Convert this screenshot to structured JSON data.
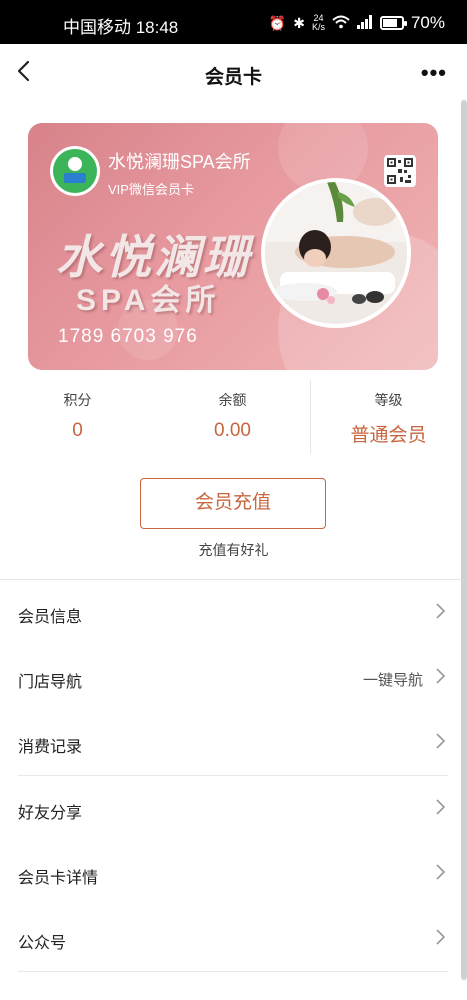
{
  "status_bar": {
    "carrier_time": "中国移动 18:48",
    "net_speed_top": "24",
    "net_speed_bottom": "K/s",
    "battery": "70%"
  },
  "navbar": {
    "title": "会员卡",
    "more": "•••"
  },
  "card": {
    "merchant_name": "水悦澜珊SPA会所",
    "card_type": "VIP微信会员卡",
    "brand_line1": "水悦澜珊",
    "brand_line2": "SPA会所",
    "card_number": "1789 6703 976",
    "colors": {
      "gradient_start": "#d8828a",
      "gradient_end": "#f1b6b6",
      "logo_green": "#3cb45a"
    }
  },
  "stats": [
    {
      "label": "积分",
      "value": "0"
    },
    {
      "label": "余额",
      "value": "0.00"
    },
    {
      "label": "等级",
      "value": "普通会员"
    }
  ],
  "recharge": {
    "button_label": "会员充值",
    "promo_text": "充值有好礼",
    "accent_color": "#c7663f"
  },
  "menu": [
    {
      "label": "会员信息",
      "extra": ""
    },
    {
      "label": "门店导航",
      "extra": "一键导航"
    },
    {
      "label": "消费记录",
      "extra": ""
    },
    {
      "label": "好友分享",
      "extra": ""
    },
    {
      "label": "会员卡详情",
      "extra": ""
    },
    {
      "label": "公众号",
      "extra": ""
    }
  ]
}
